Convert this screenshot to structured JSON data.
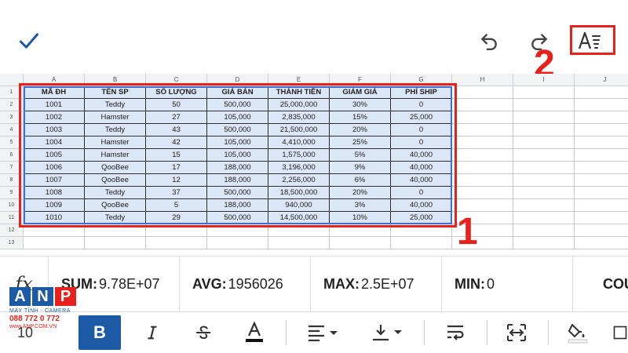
{
  "topbar": {
    "icons": [
      "check-icon",
      "undo-icon",
      "redo-icon",
      "text-format-icon"
    ]
  },
  "annotations": {
    "label_1": "1",
    "label_2": "2"
  },
  "sheet": {
    "columns": [
      "A",
      "B",
      "C",
      "D",
      "E",
      "F",
      "G",
      "H",
      "I",
      "J"
    ],
    "rows": [
      "1",
      "2",
      "3",
      "4",
      "5",
      "6",
      "7",
      "8",
      "9",
      "10",
      "11",
      "12",
      "13"
    ],
    "cells": [
      [
        "MÃ ĐH",
        "TÊN SP",
        "SỐ LƯỢNG",
        "GIÁ BÁN",
        "THÀNH TIỀN",
        "GIẢM GIÁ",
        "PHÍ SHIP"
      ],
      [
        "1001",
        "Teddy",
        "50",
        "500,000",
        "25,000,000",
        "30%",
        "0"
      ],
      [
        "1002",
        "Hamster",
        "27",
        "105,000",
        "2,835,000",
        "15%",
        "25,000"
      ],
      [
        "1003",
        "Teddy",
        "43",
        "500,000",
        "21,500,000",
        "20%",
        "0"
      ],
      [
        "1004",
        "Hamster",
        "42",
        "105,000",
        "4,410,000",
        "25%",
        "0"
      ],
      [
        "1005",
        "Hamster",
        "15",
        "105,000",
        "1,575,000",
        "5%",
        "40,000"
      ],
      [
        "1006",
        "QooBee",
        "17",
        "188,000",
        "3,196,000",
        "9%",
        "40,000"
      ],
      [
        "1007",
        "QooBee",
        "12",
        "188,000",
        "2,256,000",
        "6%",
        "40,000"
      ],
      [
        "1008",
        "Teddy",
        "37",
        "500,000",
        "18,500,000",
        "20%",
        "0"
      ],
      [
        "1009",
        "QooBee",
        "5",
        "188,000",
        "940,000",
        "3%",
        "40,000"
      ],
      [
        "1010",
        "Teddy",
        "29",
        "500,000",
        "14,500,000",
        "10%",
        "25,000"
      ]
    ]
  },
  "status": {
    "fx_label": "fx",
    "sum_label": "SUM:",
    "sum_value": " 9.78E+07",
    "avg_label": "AVG:",
    "avg_value": " 1956026",
    "max_label": "MAX:",
    "max_value": " 2.5E+07",
    "min_label": "MIN:",
    "min_value": " 0",
    "count_label": "COU"
  },
  "logo": {
    "letters": [
      "A",
      "N",
      "P"
    ],
    "tagline": "MÁY TÍNH - CAMERA",
    "phone": "088 772 0 772",
    "site": "www.ANP.COM.VN"
  },
  "toolbar": {
    "font_size": "10",
    "bold_label": "B",
    "icons": [
      "italic-icon",
      "strikethrough-icon",
      "text-color-icon",
      "horizontal-align-icon",
      "vertical-align-icon",
      "wrap-text-icon",
      "merge-cells-icon",
      "fill-color-icon"
    ]
  },
  "colors": {
    "accent": "#1d5aa6",
    "annotation": "#e8211c",
    "selection": "#dbe6f6"
  }
}
